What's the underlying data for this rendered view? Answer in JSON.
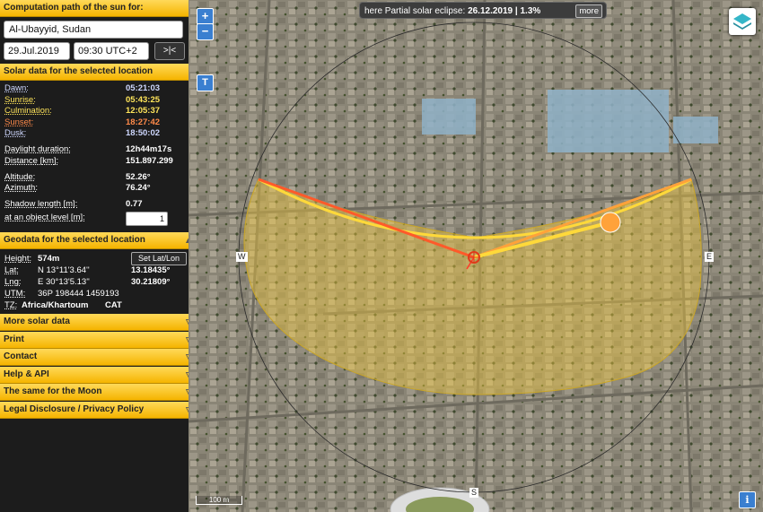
{
  "app": {
    "title": "Computation path of the sun for:",
    "location": "Al-Ubayyid, Sudan",
    "date": "29.Jul.2019",
    "time": "09:30 UTC+2",
    "now_label": ">|<"
  },
  "solar": {
    "title": "Solar data for the selected location",
    "rows": [
      {
        "label": "Dawn:",
        "value": "05:21:03",
        "color": "#cfd8ff"
      },
      {
        "label": "Sunrise:",
        "value": "05:43:25",
        "color": "#ffe55a"
      },
      {
        "label": "Culmination:",
        "value": "12:05:37",
        "color": "#ffe55a"
      },
      {
        "label": "Sunset:",
        "value": "18:27:42",
        "color": "#ff8a4a"
      },
      {
        "label": "Dusk:",
        "value": "18:50:02",
        "color": "#cfd8ff"
      },
      {
        "label": "Daylight duration:",
        "value": "12h44m17s",
        "color": "#ffffff"
      },
      {
        "label": "Distance [km]:",
        "value": "151.897.299",
        "color": "#ffffff"
      },
      {
        "label": "Altitude:",
        "value": "52.26°",
        "color": "#ffffff"
      },
      {
        "label": "Azimuth:",
        "value": "76.24°",
        "color": "#ffffff"
      },
      {
        "label": "Shadow length [m]:",
        "value": "0.77",
        "color": "#ffffff"
      },
      {
        "label": "at an object level [m]:",
        "value": "1",
        "color": "#ffffff"
      }
    ]
  },
  "geo": {
    "title": "Geodata for the selected location",
    "height_label": "Height:",
    "height_value": "574m",
    "set_btn": "Set Lat/Lon",
    "lat_label": "Lat:",
    "lat_dms": "N 13°11'3.64''",
    "lat_dec": "13.18435°",
    "lng_label": "Lng:",
    "lng_dms": "E 30°13'5.13''",
    "lng_dec": "30.21809°",
    "utm_label": "UTM:",
    "utm_value": "36P 198444 1459193",
    "tz_label": "TZ:",
    "tz_value": "Africa/Khartoum",
    "tz_abbr": "CAT"
  },
  "sections": [
    "More solar data",
    "Print",
    "Contact",
    "Help & API",
    "The same for the Moon",
    "Legal Disclosure / Privacy Policy"
  ],
  "map": {
    "eclipse_text": "here Partial solar eclipse: ",
    "eclipse_date": "26.12.2019",
    "eclipse_pct": " | 1.3%",
    "more": "more",
    "zoom_in": "+",
    "zoom_out": "−",
    "t_btn": "T",
    "info_btn": "i",
    "scale": "100 m",
    "compass": {
      "w": "W",
      "e": "E",
      "s": "S"
    }
  },
  "colors": {
    "header": "#f5b400",
    "sun": "#ffa23a",
    "sunrise_line": "#ffd93a",
    "sunset_line": "#ff5a2a",
    "day_area": "#f0c840"
  }
}
